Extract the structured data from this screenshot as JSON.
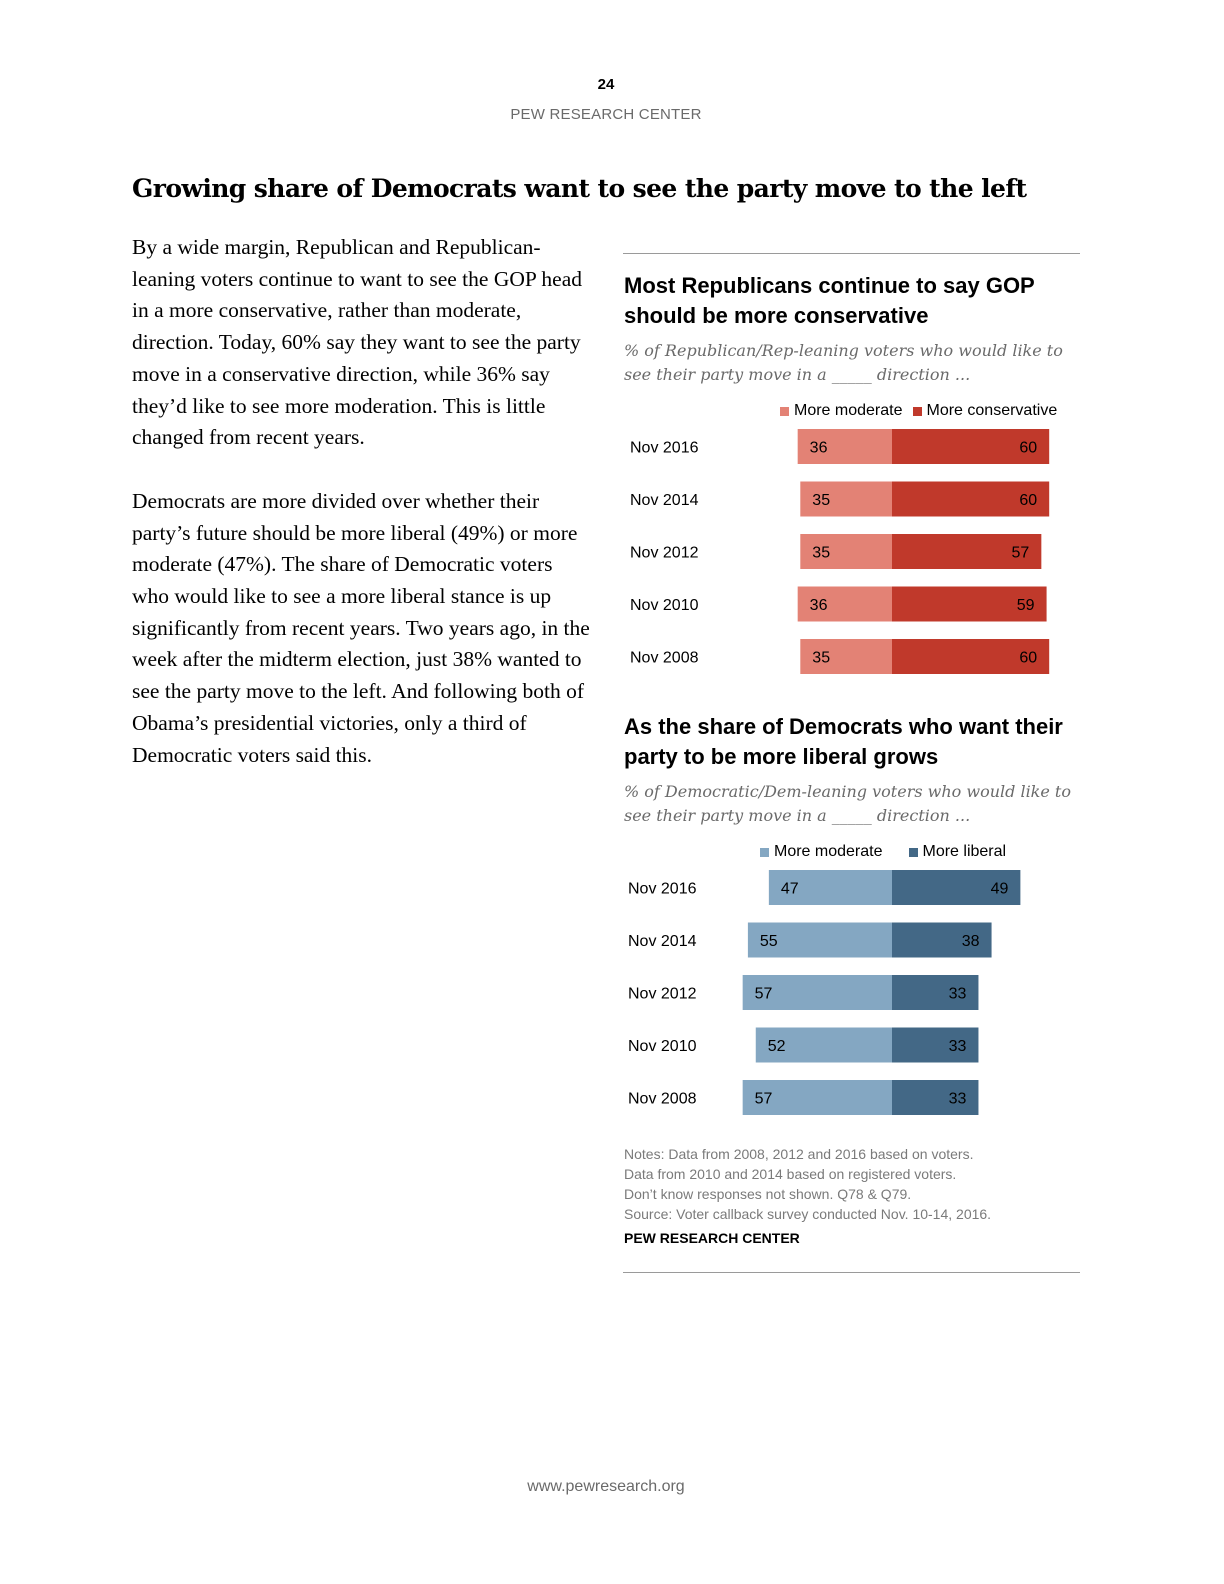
{
  "header": {
    "page_number": "24",
    "org": "PEW RESEARCH CENTER"
  },
  "headline": "Growing share of Democrats want to see the party move to the left",
  "body": {
    "paragraph1": "By a wide margin, Republican and Republican-leaning voters continue to want to see the GOP head in a more conservative, rather than moderate, direction. Today, 60% say they want to see the party move in a conservative direction, while 36% say they’d like to see more moderation. This is little changed from recent years.",
    "paragraph2": "Democrats are more divided over whether their party’s future should be more liberal (49%) or more moderate (47%). The share of Democratic voters who would like to see a more liberal stance is up significantly from recent years. Two years ago, in the week after the midterm election, just 38% wanted to see the party move to the left. And following both of Obama’s presidential victories, only a third of Democratic voters said this."
  },
  "chart_data": [
    {
      "type": "bar",
      "orientation": "horizontal-diverging",
      "title": "Most Republicans continue to say GOP should be more conservative",
      "subtitle": "% of Republican/Rep-leaning voters who would like to see their party move in a _____ direction ...",
      "categories": [
        "Nov 2016",
        "Nov 2014",
        "Nov 2012",
        "Nov 2010",
        "Nov 2008"
      ],
      "series": [
        {
          "name": "More moderate",
          "color": "#e38275",
          "values": [
            36,
            35,
            35,
            36,
            35
          ]
        },
        {
          "name": "More conservative",
          "color": "#c0392b",
          "values": [
            60,
            60,
            57,
            59,
            60
          ]
        }
      ],
      "legend": "top-right"
    },
    {
      "type": "bar",
      "orientation": "horizontal-diverging",
      "title": "As the share of Democrats who want their party to be more liberal grows",
      "subtitle": "% of Democratic/Dem-leaning voters who would like to see their party move in a _____ direction ...",
      "categories": [
        "Nov 2016",
        "Nov 2014",
        "Nov 2012",
        "Nov 2010",
        "Nov 2008"
      ],
      "series": [
        {
          "name": "More moderate",
          "color": "#84a7c2",
          "values": [
            47,
            55,
            57,
            52,
            57
          ]
        },
        {
          "name": "More liberal",
          "color": "#436886",
          "values": [
            49,
            38,
            33,
            33,
            33
          ]
        }
      ],
      "legend": "top-right"
    }
  ],
  "notes": [
    "Notes: Data from 2008, 2012 and 2016 based on voters.",
    "Data from 2010 and 2014 based on registered voters.",
    "Don’t know responses not shown. Q78 & Q79.",
    "Source: Voter callback survey conducted Nov. 10-14, 2016."
  ],
  "source_org": "PEW RESEARCH CENTER",
  "footer": {
    "url": "www.pewresearch.org"
  }
}
